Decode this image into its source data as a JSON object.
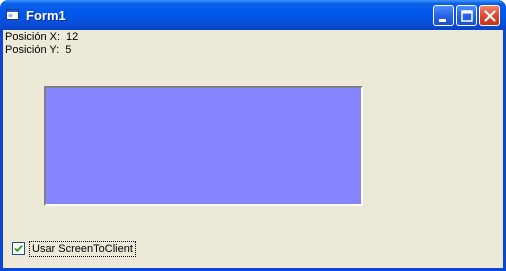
{
  "window": {
    "title": "Form1",
    "colors": {
      "titlebar": "#0058ee",
      "client": "#ece9d8",
      "panel": "#8585ff"
    }
  },
  "titlebar_buttons": {
    "minimize_icon": "minimize-icon",
    "maximize_icon": "maximize-icon",
    "close_icon": "close-icon"
  },
  "position": {
    "x_label": "Posición X:",
    "x_value": "12",
    "y_label": "Posición Y:",
    "y_value": "5"
  },
  "checkbox": {
    "label": "Usar ScreenToClient",
    "checked": true
  }
}
